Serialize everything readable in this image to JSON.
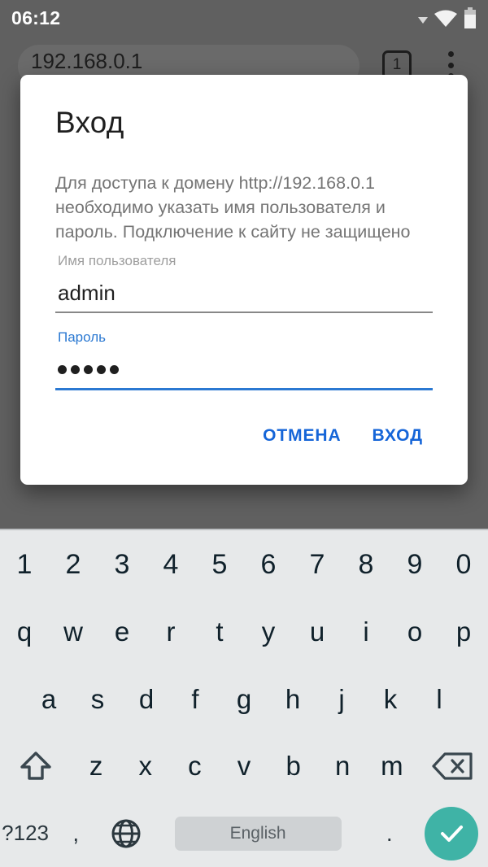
{
  "status_bar": {
    "clock": "06:12",
    "icons": [
      "dropdown-triangle-icon",
      "wifi-icon",
      "battery-icon"
    ]
  },
  "browser": {
    "url": "192.168.0.1",
    "tab_count": "1",
    "overflow_menu_icon": "three-dot-menu-icon"
  },
  "dialog": {
    "title": "Вход",
    "message": "Для доступа к домену http://192.168.0.1 необходимо указать имя пользователя и пароль. Подключение к сайту не защищено",
    "username": {
      "label": "Имя пользователя",
      "value": "admin"
    },
    "password": {
      "label": "Пароль",
      "value": "•••••",
      "dot_count": 5
    },
    "cancel_label": "ОТМЕНА",
    "submit_label": "ВХОД",
    "accent_color": "#1565d8",
    "focus_color": "#2b79d2"
  },
  "keyboard": {
    "layout": "qwerty",
    "row_numbers": [
      "1",
      "2",
      "3",
      "4",
      "5",
      "6",
      "7",
      "8",
      "9",
      "0"
    ],
    "row_top": [
      "q",
      "w",
      "e",
      "r",
      "t",
      "y",
      "u",
      "i",
      "o",
      "p"
    ],
    "row_home": [
      "a",
      "s",
      "d",
      "f",
      "g",
      "h",
      "j",
      "k",
      "l"
    ],
    "row_bottom": [
      "z",
      "x",
      "c",
      "v",
      "b",
      "n",
      "m"
    ],
    "shift_icon": "shift-arrow-icon",
    "backspace_icon": "backspace-icon",
    "symbols_label": "?123",
    "comma_label": ",",
    "language_icon": "globe-icon",
    "space_label": "English",
    "period_label": ".",
    "enter_icon": "checkmark-icon",
    "enter_color": "#3fb3a6",
    "background_color": "#e7e9ea"
  }
}
